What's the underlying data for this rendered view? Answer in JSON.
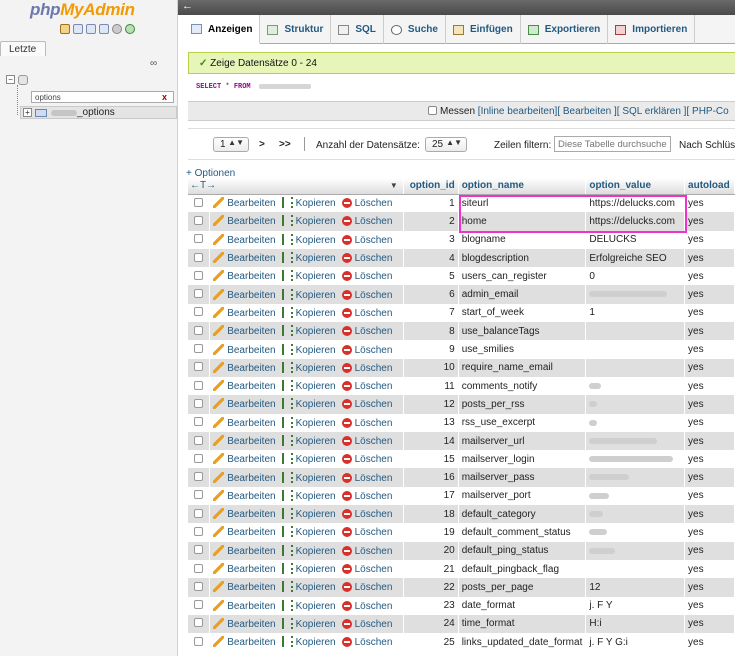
{
  "nav": {
    "logo_part1": "php",
    "logo_part2": "MyAdmin",
    "icons": [
      "home-icon",
      "database-icon",
      "info-icon",
      "docs-icon",
      "gear-icon",
      "reload-icon"
    ],
    "recent_label": "Letzte",
    "link_icon": "∞",
    "filter_value": "options",
    "filter_clear": "x",
    "table_suffix": "_options"
  },
  "topbar": {
    "back": "←"
  },
  "tabs": [
    {
      "label": "Anzeigen",
      "icon": "browse-icon",
      "active": true
    },
    {
      "label": "Struktur",
      "icon": "structure-icon"
    },
    {
      "label": "SQL",
      "icon": "sql-icon"
    },
    {
      "label": "Suche",
      "icon": "search-icon"
    },
    {
      "label": "Einfügen",
      "icon": "insert-icon"
    },
    {
      "label": "Exportieren",
      "icon": "export-icon"
    },
    {
      "label": "Importieren",
      "icon": "import-icon"
    }
  ],
  "success": {
    "check": "✓",
    "message": "Zeige Datensätze 0 - 24"
  },
  "sql": {
    "select": "SELECT",
    "star": "*",
    "from": "FROM"
  },
  "sql_links": {
    "profiling": "Messen",
    "inline_edit": "[Inline bearbeiten]",
    "edit": "[ Bearbeiten ]",
    "explain": "[ SQL erklären ]",
    "php_code": "[ PHP-Co"
  },
  "controls": {
    "page_value": "1",
    "page_next": ">",
    "page_last": ">>",
    "rows_label": "Anzahl der Datensätze:",
    "rows_value": "25",
    "filter_label": "Zeilen filtern:",
    "filter_placeholder": "Diese Tabelle durchsuchen",
    "sort_label": "Nach Schlüs"
  },
  "table": {
    "options_link": "+ Optionen",
    "col_arrows": "←T→",
    "sort_arrow": "▼",
    "headers": {
      "option_id": "option_id",
      "option_name": "option_name",
      "option_value": "option_value",
      "autoload": "autoload"
    },
    "actions": {
      "edit": "Bearbeiten",
      "copy": "Kopieren",
      "delete": "Löschen"
    },
    "rows": [
      {
        "id": "1",
        "name": "siteurl",
        "value": "https://delucks.com",
        "autoload": "yes"
      },
      {
        "id": "2",
        "name": "home",
        "value": "https://delucks.com",
        "autoload": "yes"
      },
      {
        "id": "3",
        "name": "blogname",
        "value": "DELUCKS",
        "autoload": "yes"
      },
      {
        "id": "4",
        "name": "blogdescription",
        "value": "Erfolgreiche SEO",
        "autoload": "yes"
      },
      {
        "id": "5",
        "name": "users_can_register",
        "value": "0",
        "autoload": "yes"
      },
      {
        "id": "6",
        "name": "admin_email",
        "value": "",
        "autoload": "yes"
      },
      {
        "id": "7",
        "name": "start_of_week",
        "value": "1",
        "autoload": "yes"
      },
      {
        "id": "8",
        "name": "use_balanceTags",
        "value": "",
        "autoload": "yes"
      },
      {
        "id": "9",
        "name": "use_smilies",
        "value": "",
        "autoload": "yes"
      },
      {
        "id": "10",
        "name": "require_name_email",
        "value": "",
        "autoload": "yes"
      },
      {
        "id": "11",
        "name": "comments_notify",
        "value": "",
        "autoload": "yes"
      },
      {
        "id": "12",
        "name": "posts_per_rss",
        "value": "",
        "autoload": "yes"
      },
      {
        "id": "13",
        "name": "rss_use_excerpt",
        "value": "",
        "autoload": "yes"
      },
      {
        "id": "14",
        "name": "mailserver_url",
        "value": "",
        "autoload": "yes"
      },
      {
        "id": "15",
        "name": "mailserver_login",
        "value": "",
        "autoload": "yes"
      },
      {
        "id": "16",
        "name": "mailserver_pass",
        "value": "",
        "autoload": "yes"
      },
      {
        "id": "17",
        "name": "mailserver_port",
        "value": "",
        "autoload": "yes"
      },
      {
        "id": "18",
        "name": "default_category",
        "value": "",
        "autoload": "yes"
      },
      {
        "id": "19",
        "name": "default_comment_status",
        "value": "",
        "autoload": "yes"
      },
      {
        "id": "20",
        "name": "default_ping_status",
        "value": "",
        "autoload": "yes"
      },
      {
        "id": "21",
        "name": "default_pingback_flag",
        "value": "",
        "autoload": "yes"
      },
      {
        "id": "22",
        "name": "posts_per_page",
        "value": "12",
        "autoload": "yes"
      },
      {
        "id": "23",
        "name": "date_format",
        "value": "j. F Y",
        "autoload": "yes"
      },
      {
        "id": "24",
        "name": "time_format",
        "value": "H:i",
        "autoload": "yes"
      },
      {
        "id": "25",
        "name": "links_updated_date_format",
        "value": "j. F Y G:i",
        "autoload": "yes"
      }
    ]
  }
}
